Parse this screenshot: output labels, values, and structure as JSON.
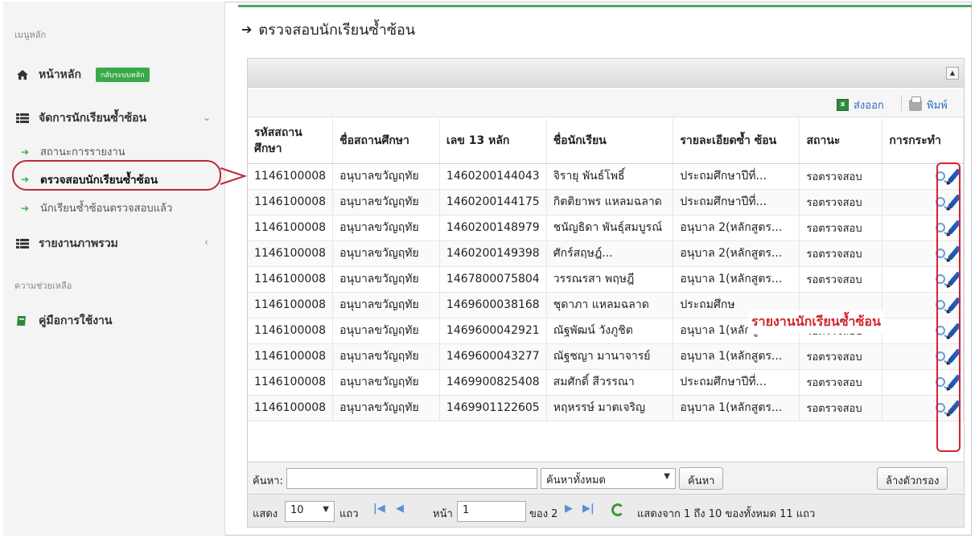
{
  "sidebar": {
    "main_header": "เมนูหลัก",
    "home_label": "หน้าหลัก",
    "home_badge": "กลับระบบหลัก",
    "manage_label": "จัดการนักเรียนซ้ำซ้อน",
    "sub_items": [
      {
        "label": "สถานะการรายงาน"
      },
      {
        "label": "ตรวจสอบนักเรียนซ้ำซ้อน"
      },
      {
        "label": "นักเรียนซ้ำซ้อนตรวจสอบแล้ว"
      }
    ],
    "report_label": "รายงานภาพรวม",
    "help_header": "ความช่วยเหลือ",
    "manual_label": "คู่มือการใช้งาน"
  },
  "main": {
    "title": "ตรวจสอบนักเรียนซ้ำซ้อน"
  },
  "toolbar": {
    "export_label": "ส่งออก",
    "print_label": "พิมพ์"
  },
  "table": {
    "headers": [
      "รหัสสถาน ศึกษา",
      "ชื่อสถานศึกษา",
      "เลข 13 หลัก",
      "ชื่อนักเรียน",
      "รายละเอียดซ้ำ ซ้อน",
      "สถานะ",
      "การกระทำ"
    ],
    "rows": [
      {
        "code": "1146100008",
        "school": "อนุบาลขวัญฤทัย",
        "id13": "1460200144043",
        "student": "จิรายุ พันธ์โพธิ์",
        "detail": "ประถมศึกษาปีที่...",
        "status": "รอตรวจสอบ"
      },
      {
        "code": "1146100008",
        "school": "อนุบาลขวัญฤทัย",
        "id13": "1460200144175",
        "student": "กิตติยาพร แหลมฉลาด",
        "detail": "ประถมศึกษาปีที่...",
        "status": "รอตรวจสอบ"
      },
      {
        "code": "1146100008",
        "school": "อนุบาลขวัญฤทัย",
        "id13": "1460200148979",
        "student": "ชนัญธิดา พันธุ์สมบูรณ์",
        "detail": "อนุบาล 2(หลักสูตร...",
        "status": "รอตรวจสอบ"
      },
      {
        "code": "1146100008",
        "school": "อนุบาลขวัญฤทัย",
        "id13": "1460200149398",
        "student": "ศักร์สฤษฎ์...",
        "detail": "อนุบาล 2(หลักสูตร...",
        "status": "รอตรวจสอบ"
      },
      {
        "code": "1146100008",
        "school": "อนุบาลขวัญฤทัย",
        "id13": "1467800075804",
        "student": "วรรณรสา พฤษฎี",
        "detail": "อนุบาล 1(หลักสูตร...",
        "status": "รอตรวจสอบ"
      },
      {
        "code": "1146100008",
        "school": "อนุบาลขวัญฤทัย",
        "id13": "1469600038168",
        "student": "ชุดาภา แหลมฉลาด",
        "detail": "ประถมศึกษ",
        "status": ""
      },
      {
        "code": "1146100008",
        "school": "อนุบาลขวัญฤทัย",
        "id13": "1469600042921",
        "student": "ณัฐพัฒน์ วังภูชิต",
        "detail": "อนุบาล 1(หลักสูตร...",
        "status": "รอตรวจสอบ"
      },
      {
        "code": "1146100008",
        "school": "อนุบาลขวัญฤทัย",
        "id13": "1469600043277",
        "student": "ณัฐชญา มานาจารย์",
        "detail": "อนุบาล 1(หลักสูตร...",
        "status": "รอตรวจสอบ"
      },
      {
        "code": "1146100008",
        "school": "อนุบาลขวัญฤทัย",
        "id13": "1469900825408",
        "student": "สมศักดิ์ สีวรรณา",
        "detail": "ประถมศึกษาปีที่...",
        "status": "รอตรวจสอบ"
      },
      {
        "code": "1146100008",
        "school": "อนุบาลขวัญฤทัย",
        "id13": "1469901122605",
        "student": "หฤหรรษ์ มาตเจริญ",
        "detail": "อนุบาล 1(หลักสูตร...",
        "status": "รอตรวจสอบ"
      }
    ]
  },
  "annotation": {
    "text": "รายงานนักเรียนซ้ำซ้อน"
  },
  "search": {
    "label": "ค้นหา:",
    "value": "",
    "scope": "ค้นหาทั้งหมด",
    "button": "ค้นหา",
    "clear": "ล้างตัวกรอง"
  },
  "pager": {
    "show_label": "แสดง",
    "page_size": "10",
    "rows_label": "แถว",
    "page_label": "หน้า",
    "page_value": "1",
    "of_label": "ของ 2",
    "summary": "แสดงจาก 1 ถึง 10 ของทั้งหมด 11 แถว"
  },
  "colors": {
    "accent_green": "#3aa94b",
    "annotation_red": "#d2252f",
    "link_blue": "#2a6fb8"
  }
}
